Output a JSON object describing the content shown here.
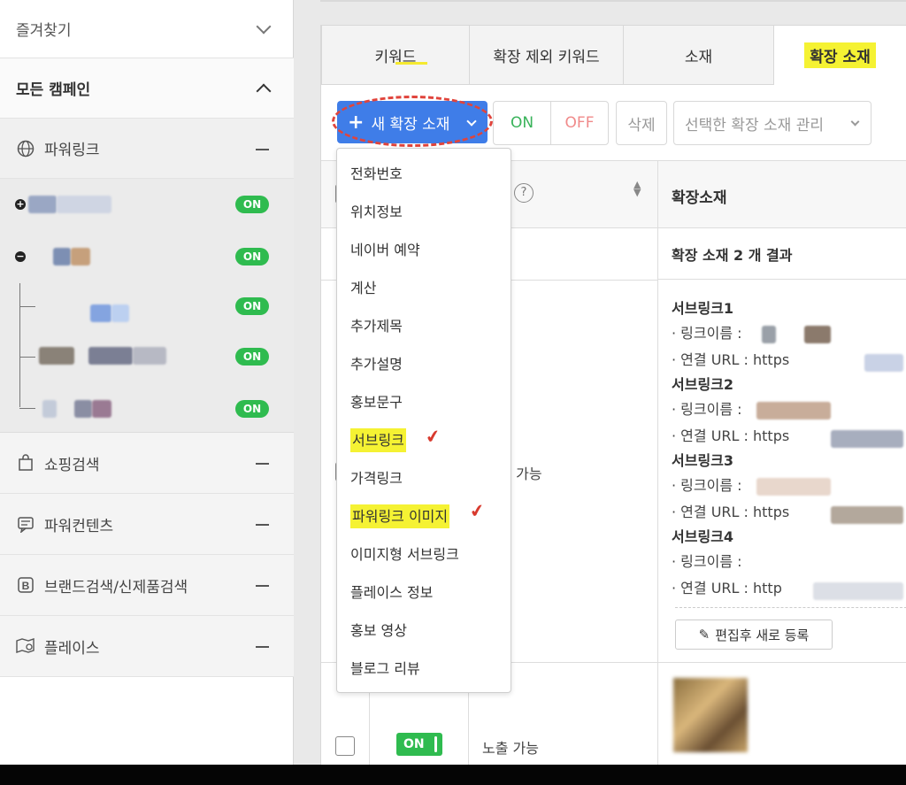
{
  "sidebar": {
    "favorites_label": "즐겨찾기",
    "all_campaigns_label": "모든 캠페인",
    "powerlink_label": "파워링크",
    "on_badge": "ON",
    "categories": [
      {
        "label": "쇼핑검색",
        "icon": "shopping-bag-icon"
      },
      {
        "label": "파워컨텐츠",
        "icon": "content-card-icon"
      },
      {
        "label": "브랜드검색/신제품검색",
        "icon": "brand-b-icon"
      },
      {
        "label": "플레이스",
        "icon": "map-pin-icon"
      }
    ]
  },
  "tabs": [
    {
      "label": "키워드",
      "active": false
    },
    {
      "label": "확장 제외 키워드",
      "active": false
    },
    {
      "label": "소재",
      "active": false
    },
    {
      "label": "확장 소재",
      "active": true
    }
  ],
  "toolbar": {
    "new_button_label": "새 확장 소재",
    "on_label": "ON",
    "off_label": "OFF",
    "delete_label": "삭제",
    "manage_label": "선택한 확장 소재 관리"
  },
  "table": {
    "ext_header": "확장소재",
    "result_text": "확장 소재 2 개 결과",
    "exposure_possible": "가능",
    "exposure_possible_full": "노출 가능",
    "row_toggle": "ON"
  },
  "sublinks": [
    {
      "title": "서브링크1",
      "name_label": "· 링크이름 :",
      "url_label": "· 연결 URL : https"
    },
    {
      "title": "서브링크2",
      "name_label": "· 링크이름 :",
      "url_label": "· 연결 URL : https"
    },
    {
      "title": "서브링크3",
      "name_label": "· 링크이름 :",
      "url_label": "· 연결 URL : https"
    },
    {
      "title": "서브링크4",
      "name_label": "· 링크이름 :",
      "url_label": "· 연결 URL : http"
    }
  ],
  "edit_button_label": "편집후 새로 등록",
  "dropdown": {
    "items": [
      "전화번호",
      "위치정보",
      "네이버 예약",
      "계산",
      "추가제목",
      "추가설명",
      "홍보문구",
      "서브링크",
      "가격링크",
      "파워링크 이미지",
      "이미지형 서브링크",
      "플레이스 정보",
      "홍보 영상",
      "블로그 리뷰"
    ],
    "highlighted": [
      "서브링크",
      "파워링크 이미지"
    ]
  },
  "colors": {
    "accent_blue": "#3f7de8",
    "on_green": "#2fbb4f",
    "highlight_yellow": "#f5f233",
    "annotation_red": "#e0443c"
  }
}
